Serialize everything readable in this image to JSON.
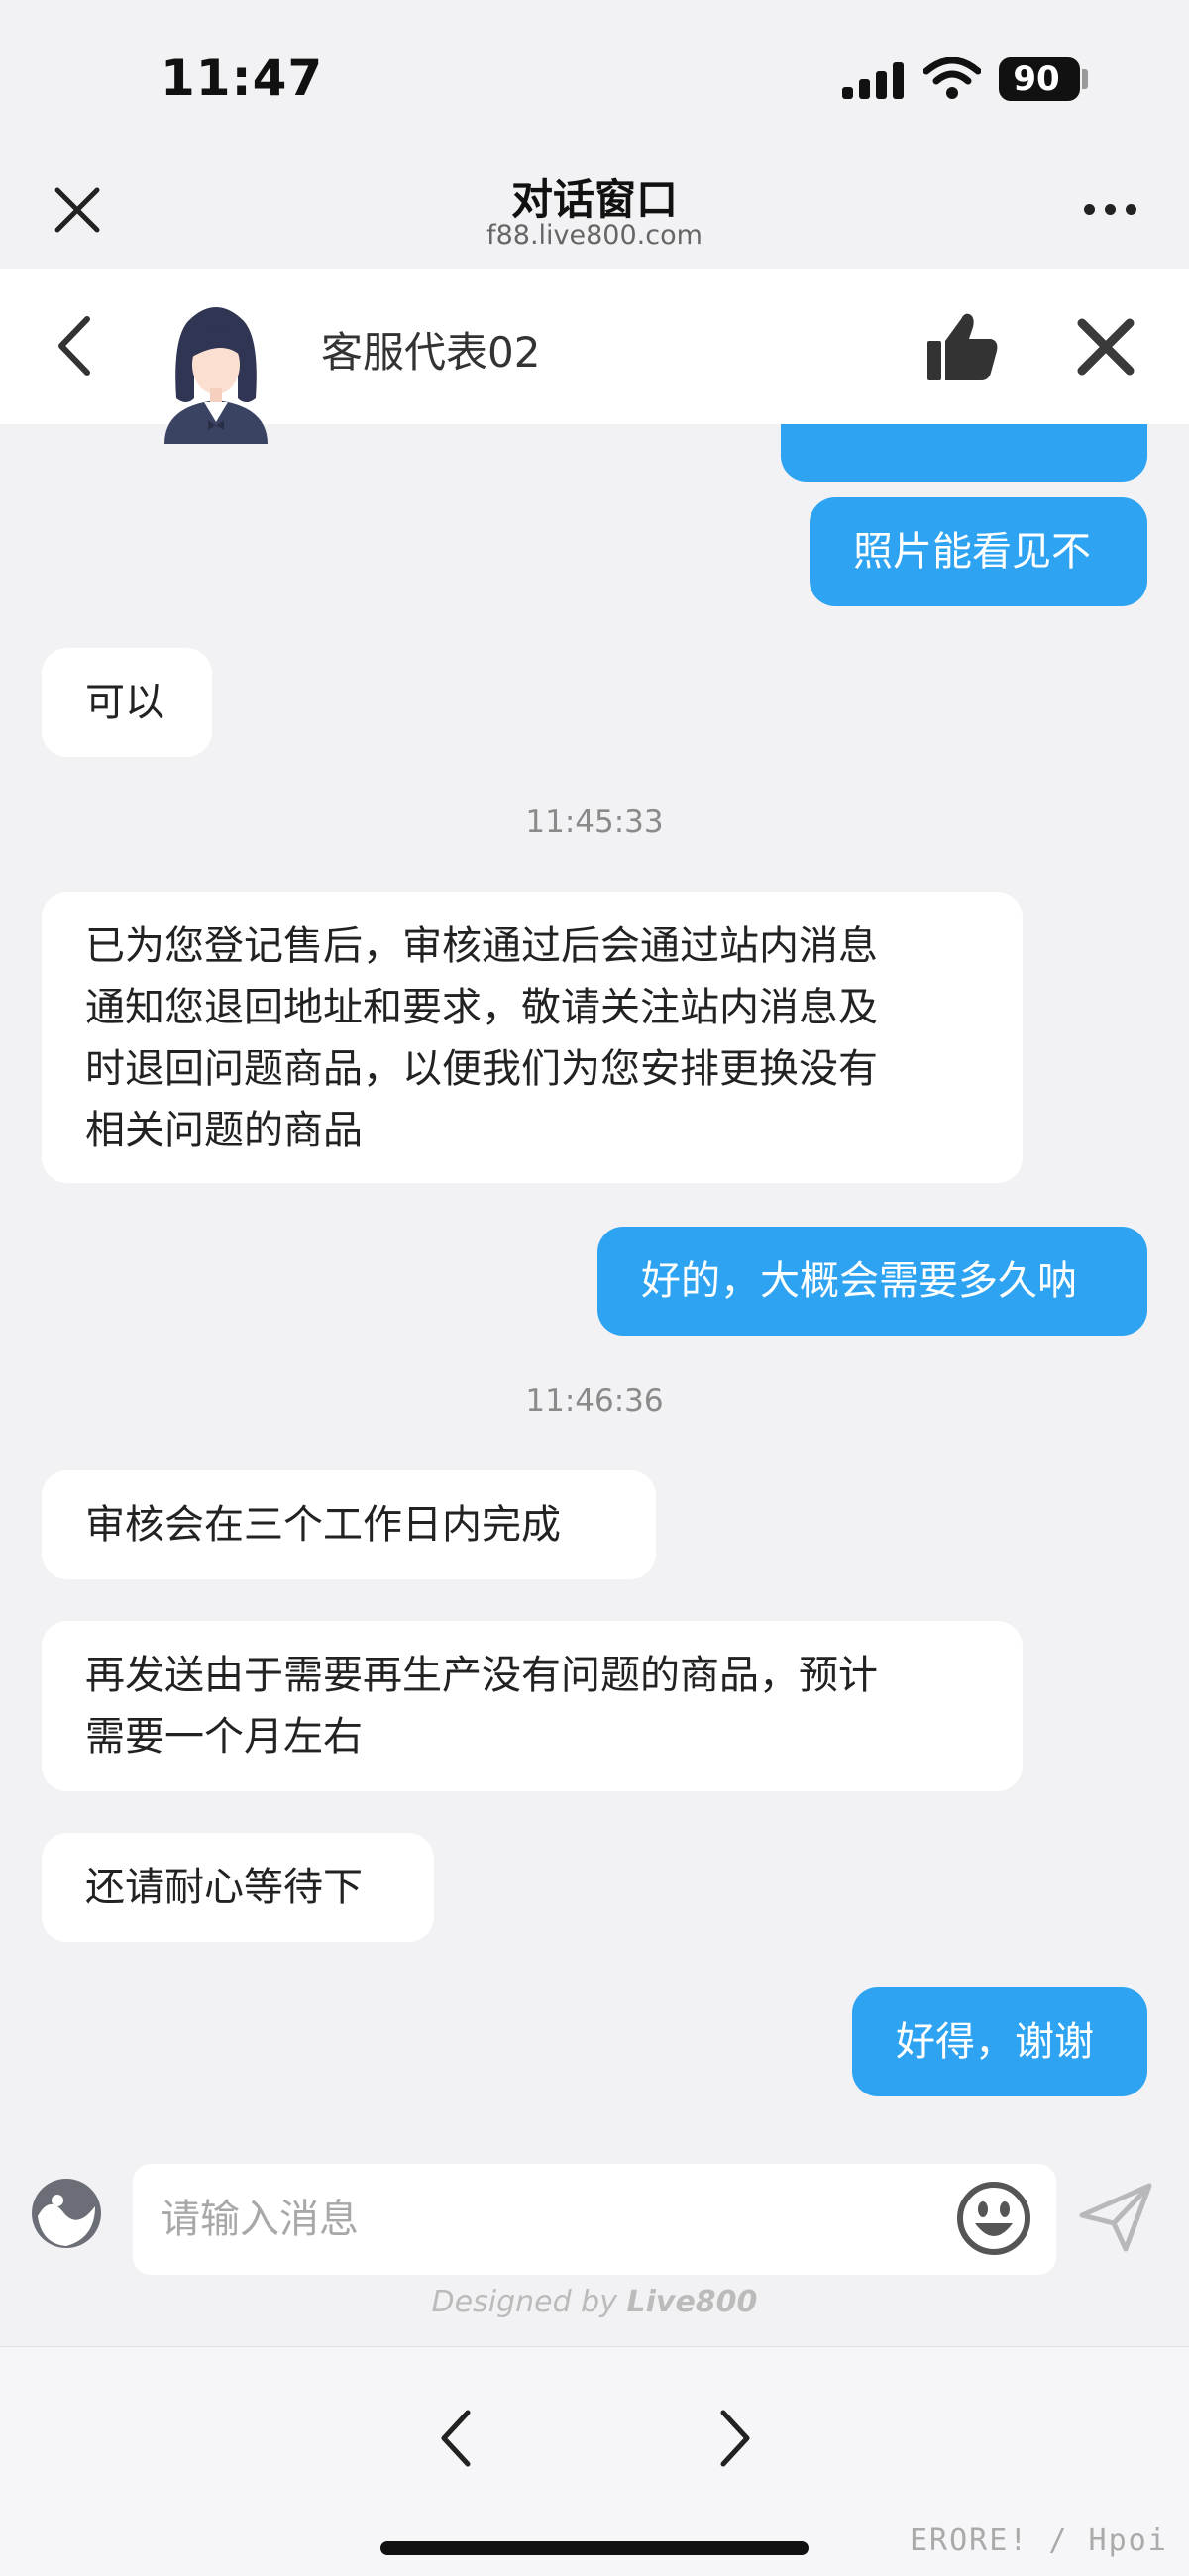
{
  "status_bar": {
    "time": "11:47",
    "battery": "90"
  },
  "browser": {
    "title": "对话窗口",
    "url": "f88.live800.com"
  },
  "agent": {
    "name": "客服代表02"
  },
  "messages": [
    {
      "from": "user",
      "text": "照片能看见不"
    },
    {
      "from": "agent",
      "text": "可以"
    },
    {
      "type": "time",
      "text": "11:45:33"
    },
    {
      "from": "agent",
      "lines": [
        "已为您登记售后，审核通过后会通过站内消息",
        "通知您退回地址和要求，敬请关注站内消息及",
        "时退回问题商品，以便我们为您安排更换没有",
        "相关问题的商品"
      ]
    },
    {
      "from": "user",
      "text": "好的，大概会需要多久呐"
    },
    {
      "type": "time",
      "text": "11:46:36"
    },
    {
      "from": "agent",
      "text": "审核会在三个工作日内完成"
    },
    {
      "from": "agent",
      "lines": [
        "再发送由于需要再生产没有问题的商品，预计",
        "需要一个月左右"
      ]
    },
    {
      "from": "agent",
      "text": "还请耐心等待下"
    },
    {
      "from": "user",
      "text": "好得，谢谢"
    }
  ],
  "input": {
    "placeholder": "请输入消息",
    "value": ""
  },
  "footer": {
    "designed_prefix": "Designed by ",
    "brand": "Live800"
  },
  "watermark": "ERORE! / Hpoi",
  "colors": {
    "user_bubble": "#2ea3f2",
    "agent_bubble": "#ffffff",
    "background": "#f2f2f4"
  },
  "icons": [
    "close-icon",
    "more-icon",
    "back-chevron-icon",
    "agent-avatar",
    "thumbs-up-icon",
    "close-bold-icon",
    "brand-icon",
    "emoji-icon",
    "send-icon",
    "nav-back-icon",
    "nav-forward-icon"
  ]
}
